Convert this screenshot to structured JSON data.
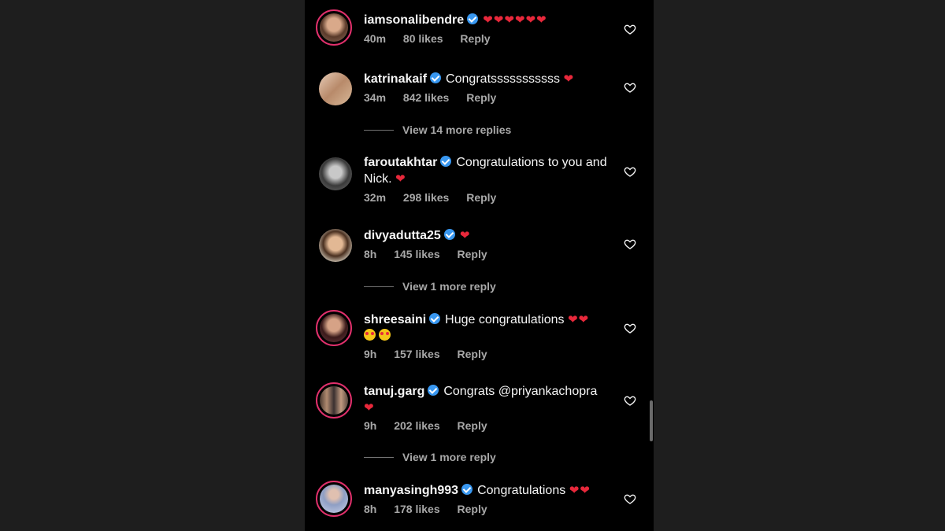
{
  "comments": [
    {
      "username": "iamsonalibendre",
      "text": "❤❤❤❤❤❤",
      "time": "40m",
      "likes": "80 likes",
      "reply": "Reply",
      "avatar_color": "#b07a5c"
    },
    {
      "username": "katrinakaif",
      "text": "Congratsssssssssss ❤",
      "time": "34m",
      "likes": "842 likes",
      "reply": "Reply",
      "avatar_color": "#c9a58e"
    },
    {
      "username": "faroutakhtar",
      "text": "Congratulations to you and",
      "text2": "Nick. ❤",
      "time": "32m",
      "likes": "298 likes",
      "reply": "Reply",
      "avatar_color": "#9a9a9a"
    },
    {
      "username": "divyadutta25",
      "text": "❤",
      "time": "8h",
      "likes": "145 likes",
      "reply": "Reply",
      "avatar_color": "#b9936f"
    },
    {
      "username": "shreesaini",
      "text": "Huge congratulations ❤❤",
      "time": "9h",
      "likes": "157 likes",
      "reply": "Reply",
      "avatar_color": "#7a4a55"
    },
    {
      "username": "tanuj.garg",
      "text": "Congrats @priyankachopra",
      "text2": "❤",
      "time": "9h",
      "likes": "202 likes",
      "reply": "Reply",
      "avatar_color": "#6e5b4d"
    },
    {
      "username": "manyasingh993",
      "text": "Congratulations ❤❤",
      "time": "8h",
      "likes": "178 likes",
      "reply": "Reply",
      "avatar_color": "#8f9fc4"
    }
  ],
  "view_more": [
    "View 14 more replies",
    "View 1 more reply",
    "View 1 more reply"
  ],
  "colors": {
    "background": "#000000",
    "text": "#f5f5f5",
    "meta": "#a8a8a8",
    "verified": "#3897f0",
    "heart": "#e8283b",
    "story_ring": "#e1306c"
  }
}
